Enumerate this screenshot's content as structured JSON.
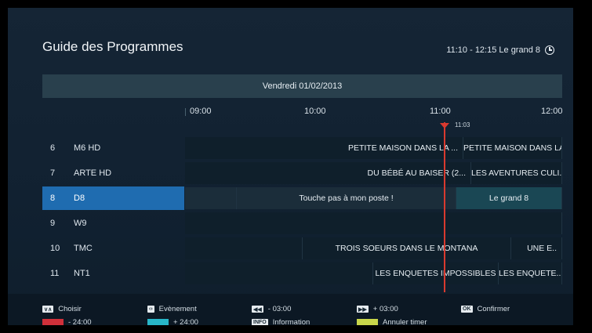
{
  "header": {
    "title": "Guide des Programmes",
    "time_info": "11:10 - 12:15  Le grand 8"
  },
  "date": "Vendredi  01/02/2013",
  "timeline": {
    "ticks": [
      "09:00",
      "10:00",
      "11:00",
      "12:00"
    ],
    "now": "11:03"
  },
  "channels": [
    {
      "num": "6",
      "name": "M6 HD",
      "programs": [
        "PETITE MAISON DANS LA ...",
        "PETITE MAISON DANS LA.."
      ]
    },
    {
      "num": "7",
      "name": "ARTE HD",
      "programs": [
        "DU BÉBÉ AU BAISER (2...",
        "LES AVENTURES CULI.."
      ]
    },
    {
      "num": "8",
      "name": "D8",
      "programs": [
        "Touche pas à mon poste !",
        "Le grand 8"
      ]
    },
    {
      "num": "9",
      "name": "W9",
      "programs": []
    },
    {
      "num": "10",
      "name": "TMC",
      "programs": [
        "TROIS SOEURS DANS LE MONTANA",
        "UNE E.."
      ]
    },
    {
      "num": "11",
      "name": "NT1",
      "programs": [
        "LES ENQUETES IMPOSSIBLES",
        "LES ENQUETE.."
      ]
    }
  ],
  "footer": {
    "choose": "Choisir",
    "minus24": "- 24:00",
    "event": "Evènement",
    "plus24": "+ 24:00",
    "minus3": "- 03:00",
    "information": "Information",
    "plus3": "+ 03:00",
    "cancel_timer": "Annuler timer",
    "confirm": "Confirmer",
    "ok_key": "OK",
    "info_key": "INFO",
    "rewind_key": "◀◀",
    "ff_key": "▶▶"
  },
  "colors": {
    "red": "#d0303a",
    "cyan": "#28b6c8",
    "yellow": "#c9d64a",
    "selected": "#1f6cb0",
    "now_line": "#d93a2f"
  }
}
